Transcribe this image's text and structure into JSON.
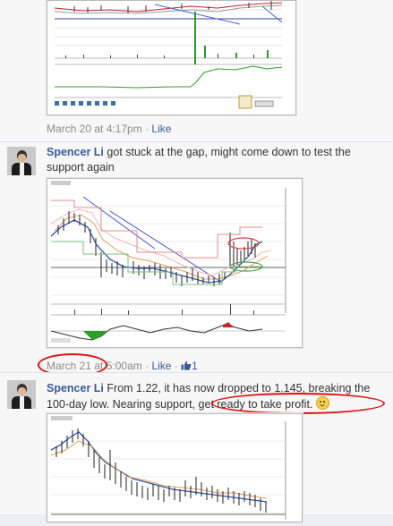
{
  "posts": [
    {
      "timestamp": "March 20 at 4:17pm",
      "like_label": "Like"
    },
    {
      "author": "Spencer Li",
      "message": "got stuck at the gap, might come down to test the support again",
      "timestamp_date": "March 21",
      "timestamp_time": "at 5:00am",
      "like_label": "Like",
      "like_count": "1"
    },
    {
      "author": "Spencer Li",
      "message_before": "From 1.22, it has now dropped to 1.145, breaking the 100-day low. Nearing support, ",
      "message_highlight": "get ready to take profit.",
      "emoticon": "smiley-icon"
    }
  ],
  "annotations": {
    "ring_color": "#dd1111"
  }
}
